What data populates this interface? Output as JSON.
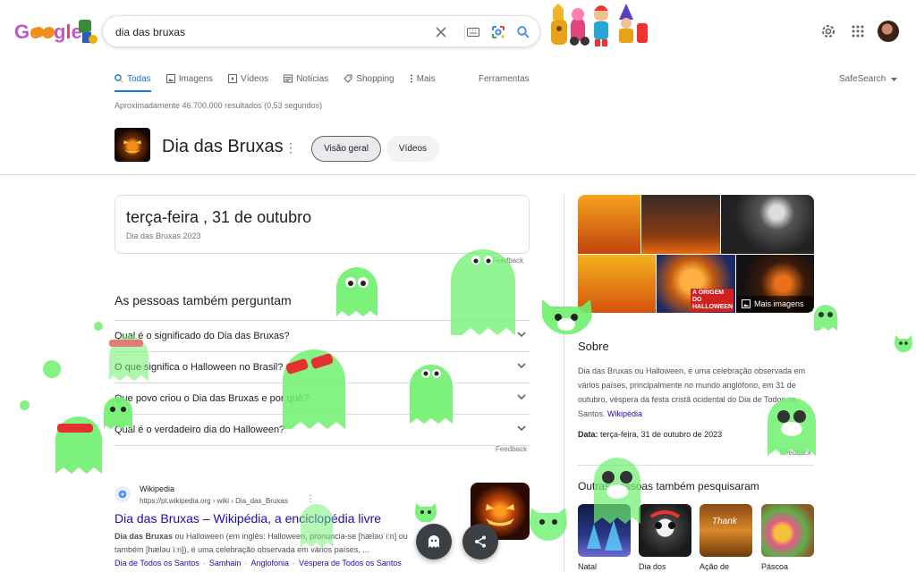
{
  "header": {
    "search_value": "dia das bruxas",
    "logo_text": "Google"
  },
  "tabs": [
    {
      "label": "Todas",
      "icon": "search-icon"
    },
    {
      "label": "Imagens",
      "icon": "image-icon"
    },
    {
      "label": "Vídeos",
      "icon": "play-icon"
    },
    {
      "label": "Notícias",
      "icon": "news-icon"
    },
    {
      "label": "Shopping",
      "icon": "tag-icon"
    },
    {
      "label": "Mais",
      "icon": "more-vert-icon"
    }
  ],
  "tools_label": "Ferramentas",
  "safesearch_label": "SafeSearch",
  "result_stats": "Aproximadamente 46.700.000 resultados (0,53 segundos)",
  "entity": {
    "title": "Dia das Bruxas",
    "chips": [
      "Visão geral",
      "Vídeos"
    ]
  },
  "date_card": {
    "main": "terça-feira , 31 de outubro",
    "sub": "Dia das Bruxas 2023",
    "feedback": "Feedback"
  },
  "paa": {
    "title": "As pessoas também perguntam",
    "questions": [
      "Qual é o significado do Dia das Bruxas?",
      "O que significa o Halloween no Brasil?",
      "Que povo criou o Dia das Bruxas e por quê?",
      "Qual é o verdadeiro dia do Halloween?"
    ],
    "feedback": "Feedback"
  },
  "result": {
    "site": "Wikipedia",
    "url": "https://pt.wikipedia.org › wiki › Dia_das_Bruxas",
    "title": "Dia das Bruxas – Wikipédia, a enciclopédia livre",
    "snippet_bold": "Dia das Bruxas",
    "snippet_line1": " ou Halloween (em inglês: Halloween, pronuncia-se [hæləʊˈiːn] ou",
    "snippet_line2": "também [hæləʊˈiːn]), é uma celebração observada em vários países, ...",
    "links": [
      "Dia de Todos os Santos",
      "Samhain",
      "Anglofonia",
      "Véspera de Todos os Santos"
    ]
  },
  "panel": {
    "more_images": "Mais imagens",
    "gallery_caption": "A ORIGEM DO HALLOWEEN",
    "about_title": "Sobre",
    "about_text": "Dia das Bruxas ou Halloween, é uma celebração observada em vários países, principalmente no mundo anglófono, em 31 de outubro, véspera da festa cristã ocidental do Dia de Todos os Santos.",
    "about_link": "Wikipédia",
    "date_label": "Data:",
    "date_value": "terça-feira, 31 de outubro de 2023",
    "feedback": "Feedback",
    "also_title": "Outras pessoas também pesquisaram",
    "also_items": [
      "Natal",
      "Dia dos",
      "Ação de",
      "Páscoa"
    ],
    "thanks_text": "Thank"
  },
  "colors": {
    "accent": "#1a73e8",
    "link": "#1a0dab",
    "ghost_green": "#6ef06e"
  }
}
